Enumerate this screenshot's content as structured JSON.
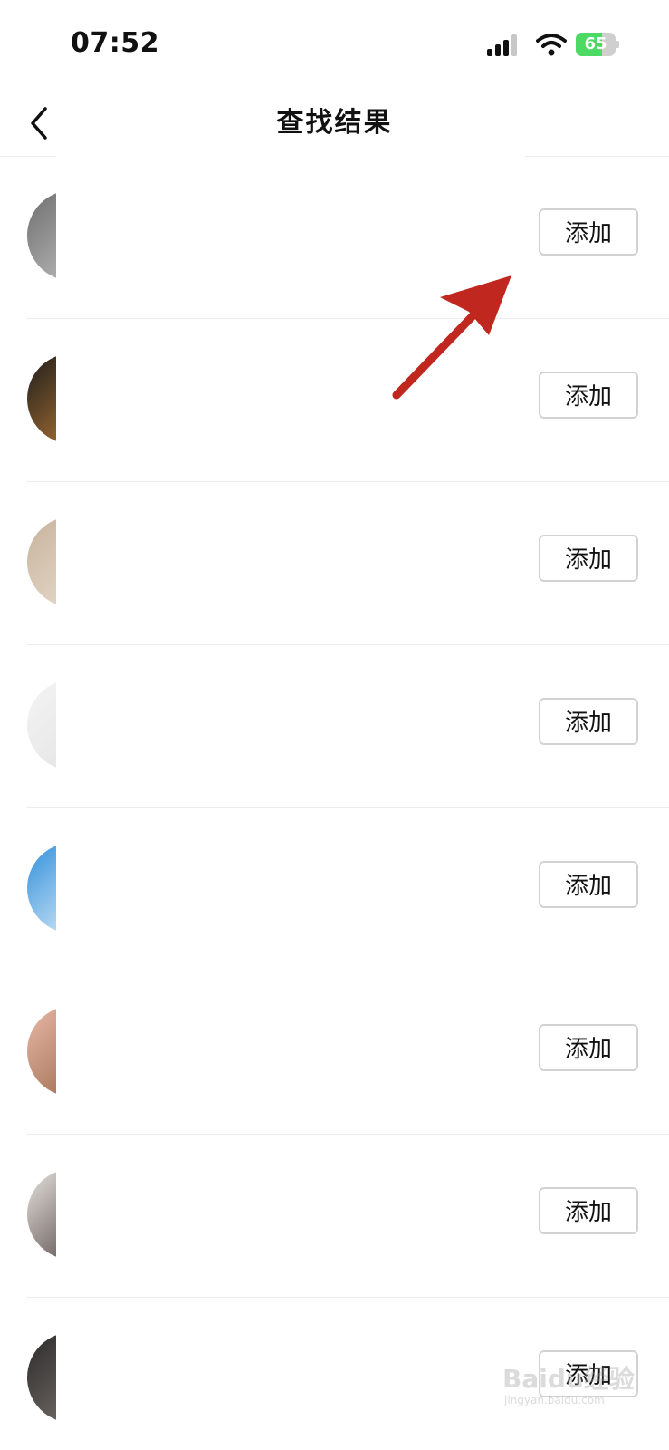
{
  "status_bar": {
    "time": "07:52",
    "battery_percent": "65",
    "battery_level": 0.65,
    "signal_bars_active": 3,
    "icons": [
      "signal-icon",
      "wifi-icon",
      "battery-charging-icon"
    ]
  },
  "nav": {
    "back_icon": "chevron-left-icon",
    "title": "查找结果"
  },
  "results": [
    {
      "avatar_colors": [
        "#6d6d6d",
        "#cfcfcf"
      ],
      "add_label": "添加"
    },
    {
      "avatar_colors": [
        "#1c1c1c",
        "#d08a3a"
      ],
      "add_label": "添加"
    },
    {
      "avatar_colors": [
        "#c6b29a",
        "#efe6da"
      ],
      "add_label": "添加"
    },
    {
      "avatar_colors": [
        "#f4f4f4",
        "#e0e0e0"
      ],
      "add_label": "添加"
    },
    {
      "avatar_colors": [
        "#2f8fdb",
        "#ffffff"
      ],
      "add_label": "添加"
    },
    {
      "avatar_colors": [
        "#e9b9a8",
        "#8a5a3a"
      ],
      "add_label": "添加"
    },
    {
      "avatar_colors": [
        "#e8e4e0",
        "#3a2a2a"
      ],
      "add_label": "添加"
    },
    {
      "avatar_colors": [
        "#2a2a2a",
        "#8a7f7a"
      ],
      "add_label": "添加"
    }
  ],
  "annotation": {
    "arrow_color": "#c0271f"
  },
  "watermark": {
    "text": "Baidu经验",
    "sub": "jingyan.baidu.com"
  }
}
